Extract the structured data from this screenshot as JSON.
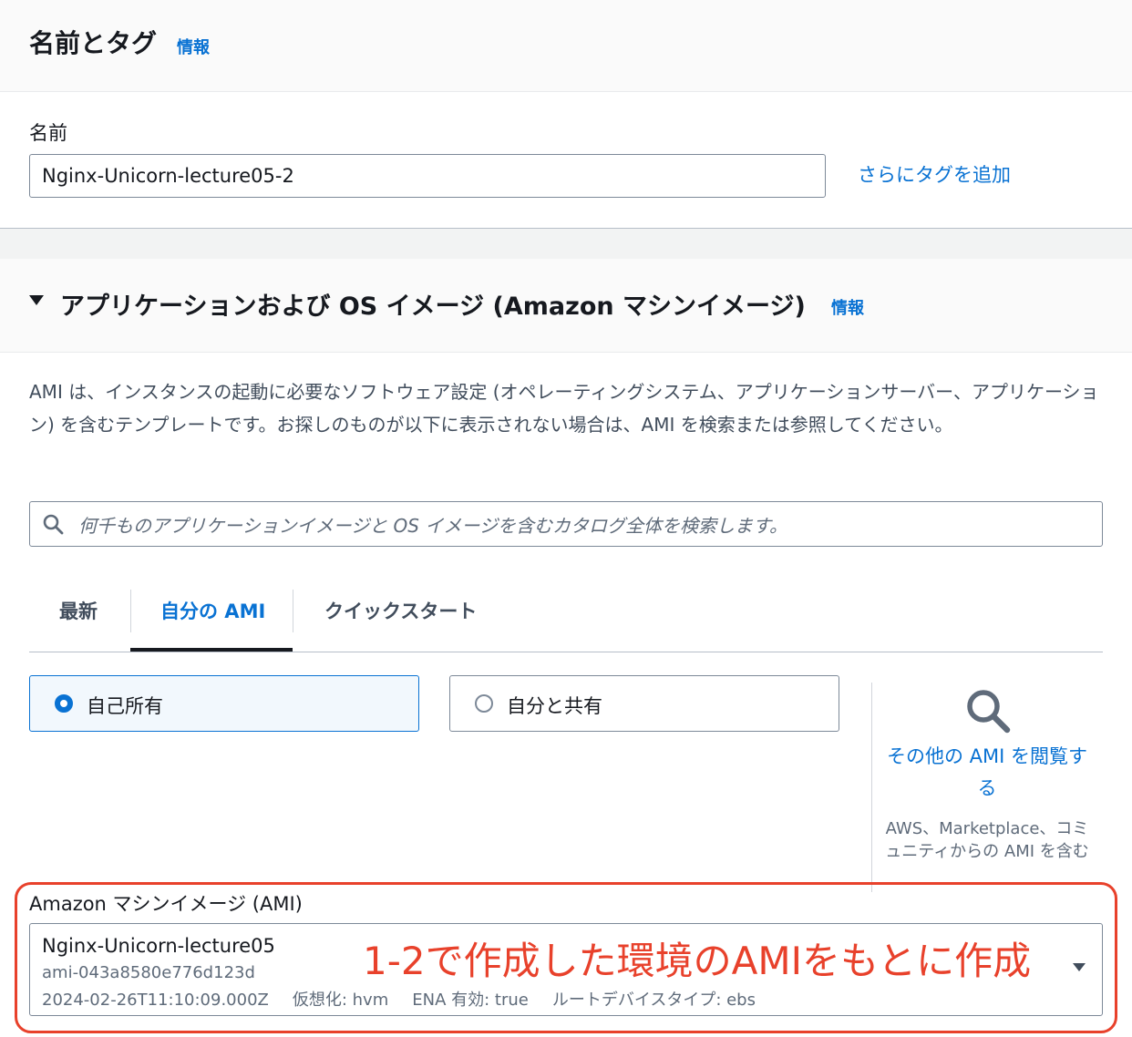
{
  "name_tags": {
    "title": "名前とタグ",
    "info": "情報",
    "name_label": "名前",
    "name_value": "Nginx-Unicorn-lecture05-2",
    "add_tags": "さらにタグを追加"
  },
  "ami_section": {
    "title": "アプリケーションおよび OS イメージ (Amazon マシンイメージ)",
    "info": "情報",
    "description": "AMI は、インスタンスの起動に必要なソフトウェア設定 (オペレーティングシステム、アプリケーションサーバー、アプリケーション) を含むテンプレートです。お探しのものが以下に表示されない場合は、AMI を検索または参照してください。",
    "search_placeholder": "何千ものアプリケーションイメージと OS イメージを含むカタログ全体を検索します。",
    "tabs": [
      {
        "label": "最新",
        "active": false
      },
      {
        "label": "自分の AMI",
        "active": true
      },
      {
        "label": "クイックスタート",
        "active": false
      }
    ],
    "ownership_options": [
      {
        "label": "自己所有",
        "selected": true
      },
      {
        "label": "自分と共有",
        "selected": false
      }
    ],
    "browse_more": {
      "link": "その他の AMI を閲覧する",
      "sub": "AWS、Marketplace、コミュニティからの AMI を含む"
    },
    "ami_select": {
      "label": "Amazon マシンイメージ (AMI)",
      "name": "Nginx-Unicorn-lecture05",
      "id": "ami-043a8580e776d123d",
      "created": "2024-02-26T11:10:09.000Z",
      "virtualization": "仮想化: hvm",
      "ena": "ENA 有効: true",
      "root_device": "ルートデバイスタイプ: ebs"
    }
  },
  "annotation": {
    "text": "1-2で作成した環境のAMIをもとに作成",
    "color": "#e8412b"
  },
  "colors": {
    "accent": "#0972d3",
    "text": "#16191f",
    "muted": "#5f6b7a"
  }
}
